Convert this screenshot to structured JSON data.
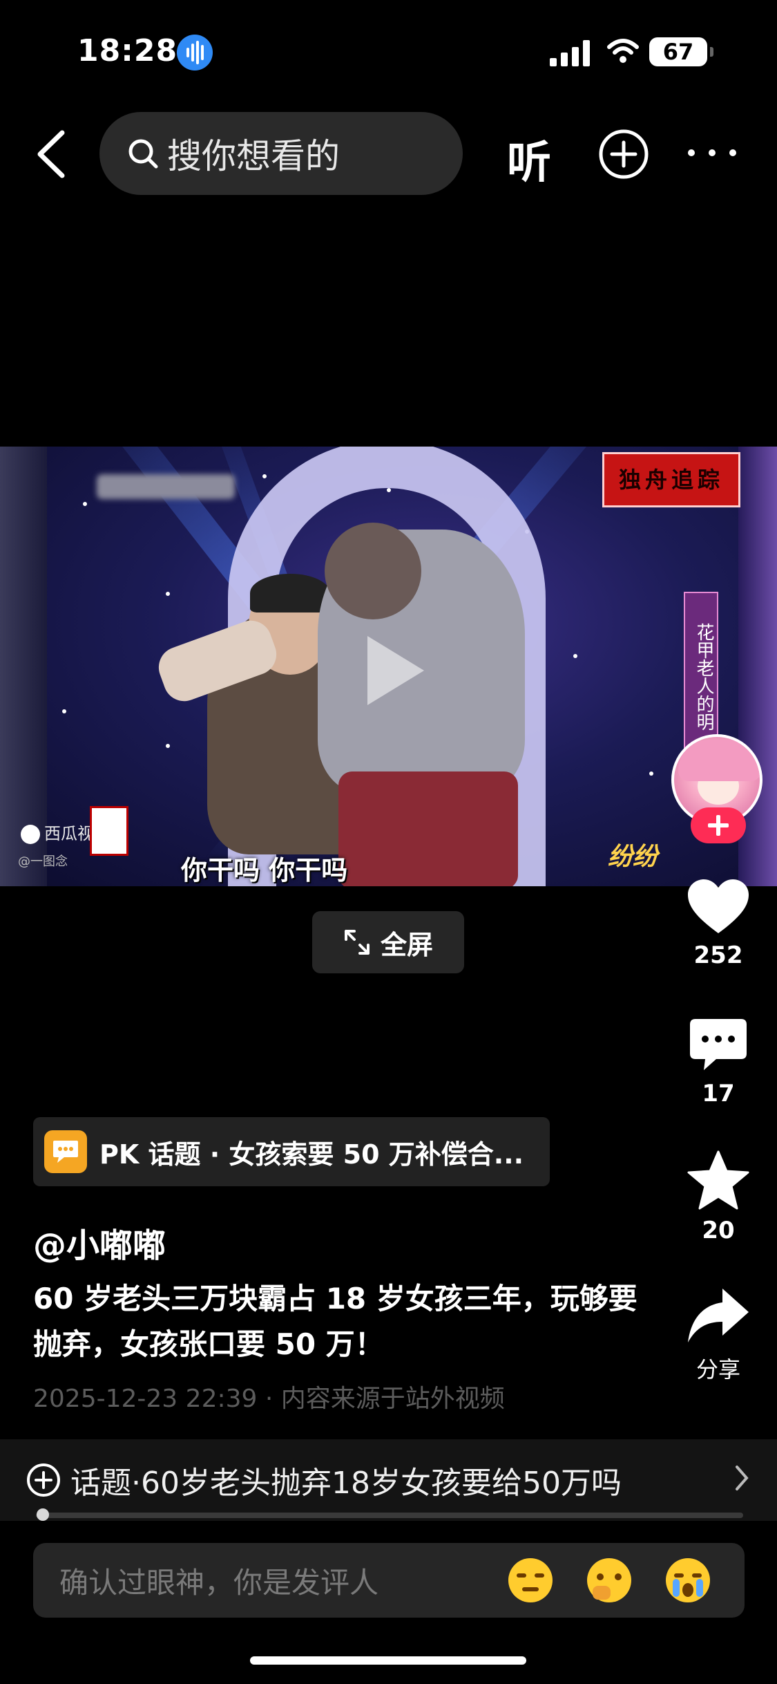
{
  "status_bar": {
    "time": "18:28",
    "battery": "67"
  },
  "top_bar": {
    "search_placeholder": "搜你想看的",
    "listen_label": "听"
  },
  "video": {
    "subtitle": "你干吗 你干吗",
    "watermark_left": "西瓜视频",
    "watermark_left_sub": "@一图念",
    "logo_text": "独舟追踪",
    "banner_text": "花甲老人的明",
    "watermark_right": "纷纷"
  },
  "fullscreen_label": "全屏",
  "rail": {
    "likes": "252",
    "comments": "17",
    "favorites": "20",
    "share_label": "分享"
  },
  "pk_topic": {
    "text": "PK 话题 · 女孩索要 50 万补偿合..."
  },
  "author": "@小嘟嘟",
  "caption": "60 岁老头三万块霸占 18 岁女孩三年，玩够要抛弃，女孩张口要 50 万！",
  "meta": "2025-12-23 22:39 · 内容来源于站外视频",
  "topic_bar": {
    "text": "话题·60岁老头抛弃18岁女孩要给50万吗"
  },
  "playback": {
    "progress_fraction": 0.01
  },
  "comment_input": {
    "placeholder": "确认过眼神，你是发评人"
  },
  "colors": {
    "accent_red": "#fe2c55",
    "pk_orange": "#f5a623"
  }
}
